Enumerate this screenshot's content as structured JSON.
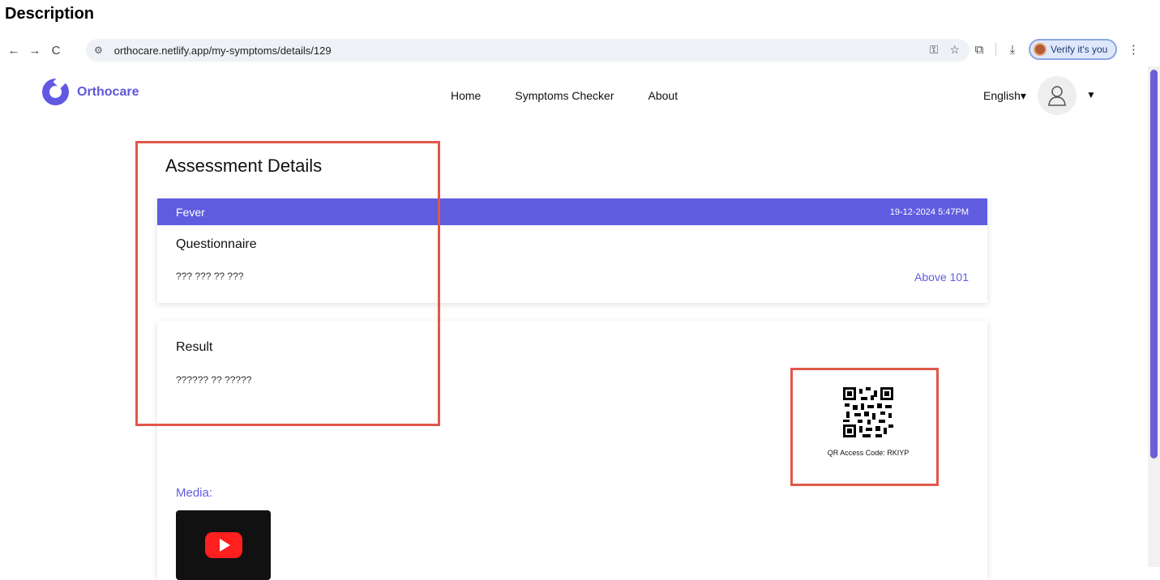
{
  "doc": {
    "heading": "Description"
  },
  "browser": {
    "back_icon": "←",
    "forward_icon": "→",
    "reload_icon": "C",
    "url": "orthocare.netlify.app/my-symptoms/details/129",
    "verify_label": "Verify it's you"
  },
  "site": {
    "brand": "Orthocare",
    "nav": [
      "Home",
      "Symptoms Checker",
      "About"
    ],
    "language": "English▾"
  },
  "assessment": {
    "title": "Assessment Details",
    "symptom": "Fever",
    "datetime": "19-12-2024 5:47PM",
    "questionnaire_title": "Questionnaire",
    "question_text": "??? ??? ?? ???",
    "answer": "Above 101",
    "result_title": "Result",
    "result_text": "?????? ?? ?????",
    "qr_caption": "QR Access Code: RKIYP",
    "media_label": "Media:"
  },
  "colors": {
    "accent": "#5f5ce0",
    "annotation": "#e0584a"
  }
}
